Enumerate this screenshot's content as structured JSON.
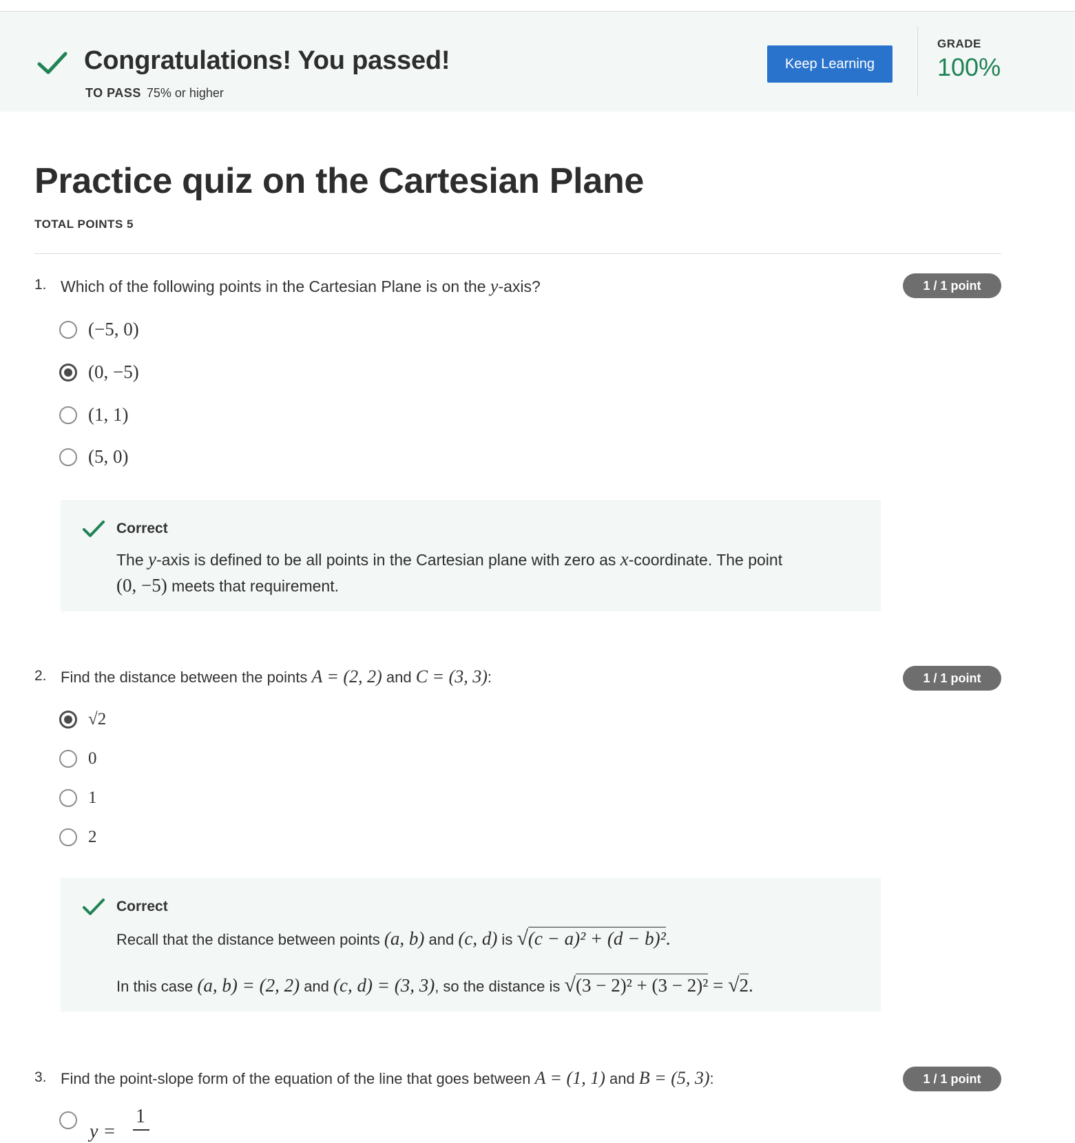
{
  "banner": {
    "title": "Congratulations! You passed!",
    "to_pass_label": "TO PASS",
    "to_pass_value": "75% or higher",
    "keep_learning": "Keep Learning",
    "grade_label": "GRADE",
    "grade_value": "100%"
  },
  "quiz": {
    "title": "Practice quiz on the Cartesian Plane",
    "total_points": "TOTAL POINTS 5"
  },
  "questions": [
    {
      "number": "1.",
      "text_pre": "Which of the following points in the Cartesian Plane is on the ",
      "text_var": "y",
      "text_post": "-axis?",
      "points": "1 / 1 point",
      "options": [
        "(−5, 0)",
        "(0, −5)",
        "(1, 1)",
        "(5, 0)"
      ],
      "selected_index": 1,
      "feedback": {
        "heading": "Correct",
        "t1": "The ",
        "v1": "y",
        "t2": "-axis is defined to be all points in the Cartesian plane with zero as ",
        "v2": "x",
        "t3": "-coordinate. The point",
        "m1": "(0, −5)",
        "t4": " meets that requirement."
      }
    },
    {
      "number": "2.",
      "text_pre": "Find the distance between the points ",
      "math_a": "A = (2, 2)",
      "text_mid": " and ",
      "math_c": "C = (3, 3)",
      "text_post": ":",
      "points": "1 / 1 point",
      "options": [
        "√2",
        "0",
        "1",
        "2"
      ],
      "selected_index": 0,
      "feedback": {
        "heading": "Correct",
        "l1_text": "Recall that the distance between points ",
        "l1_m1": "(a, b)",
        "l1_and": " and ",
        "l1_m2": "(c, d)",
        "l1_is": " is ",
        "l1_root": "(c − a)² + (d − b)²",
        "l1_end": ".",
        "l2_text": "In this case ",
        "l2_m1": "(a, b) = (2, 2)",
        "l2_and": " and ",
        "l2_m2": "(c, d) = (3, 3)",
        "l2_so": ", so the distance is ",
        "l2_root": "(3 − 2)² + (3 − 2)²",
        "l2_eq": " = ",
        "l2_root2": "2",
        "l2_end": "."
      }
    },
    {
      "number": "3.",
      "text_pre": "Find the point-slope form of the equation of the line that goes between ",
      "math_a": "A = (1, 1)",
      "text_mid": " and ",
      "math_b": "B = (5, 3)",
      "text_post": ":",
      "points": "1 / 1 point",
      "option_partial_lhs": "y =",
      "option_partial_num": "1"
    }
  ],
  "colors": {
    "banner_bg": "#f3f7f6",
    "success_green": "#1f8354",
    "button_blue": "#2a73cc",
    "badge_gray": "#6e6e6e"
  }
}
